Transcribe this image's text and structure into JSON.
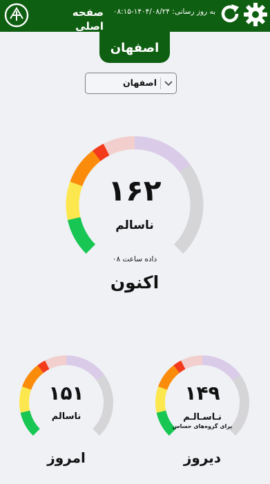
{
  "header": {
    "home_label": "صفحه اصلی",
    "updated_label": "به روز رسانی: ۱۴۰۴/۰۸/۲۴-۰۸:۱۵",
    "bg_color": "#0f5f12"
  },
  "city_tab": {
    "label": "اصفهان"
  },
  "city_select": {
    "value": "اصفهان",
    "icon": "chevron-down-icon"
  },
  "gauges": {
    "current": {
      "value": "۱۶۲",
      "status": "ناسالم",
      "note": "داده ساعت ۰۸",
      "title": "اکنون",
      "level": 0.47
    },
    "today": {
      "value": "۱۵۱",
      "status": "ناسالم",
      "title": "امروز",
      "level": 0.44
    },
    "yesterday": {
      "value": "۱۴۹",
      "status": "نـاسـالـم",
      "sub_status": "برای گروه‌های حساس",
      "title": "دیروز",
      "level": 0.43
    }
  },
  "scale_colors": {
    "good": "#17c653",
    "moderate": "#fde74f",
    "sensitive": "#fb8c0b",
    "unhealthy": "#f33a1a",
    "very_unhealthy": "#f2cfcc",
    "hazardous": "#dacbe8",
    "track": "#d5d5d7"
  }
}
